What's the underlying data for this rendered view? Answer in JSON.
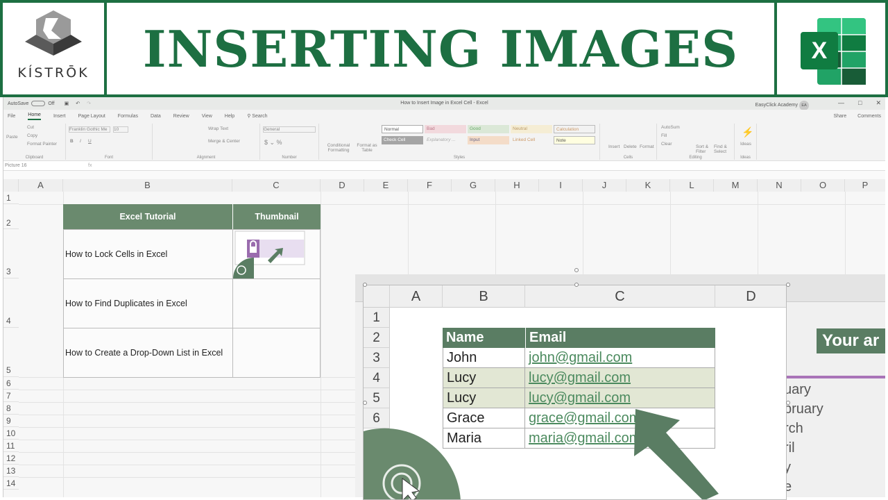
{
  "banner": {
    "title": "INSERTING IMAGES",
    "logo_text": "KÍSTRŌK",
    "excel_icon_letter": "X",
    "colors": {
      "brand_green": "#1d6f42",
      "header_green": "#6a8a6e"
    }
  },
  "window": {
    "autosave_label": "AutoSave",
    "autosave_state": "Off",
    "title": "How to Insert Image in Excel Cell  -  Excel",
    "user": "EasyClick Academy",
    "user_initials": "EA"
  },
  "tabs": {
    "items": [
      "File",
      "Home",
      "Insert",
      "Page Layout",
      "Formulas",
      "Data",
      "Review",
      "View",
      "Help"
    ],
    "active": "Home",
    "search": "Search",
    "share": "Share",
    "comments": "Comments"
  },
  "ribbon": {
    "clipboard": {
      "paste": "Paste",
      "cut": "Cut",
      "copy": "Copy",
      "format_painter": "Format Painter",
      "label": "Clipboard"
    },
    "font": {
      "name": "Franklin Gothic Me",
      "size": "10",
      "label": "Font"
    },
    "alignment": {
      "wrap": "Wrap Text",
      "merge": "Merge & Center",
      "label": "Alignment"
    },
    "number": {
      "format": "General",
      "label": "Number"
    },
    "styles": {
      "conditional": "Conditional Formatting",
      "format_table": "Format as Table",
      "cells": [
        "Normal",
        "Bad",
        "Good",
        "Neutral",
        "Calculation",
        "Check Cell",
        "Explanatory ...",
        "Input",
        "Linked Cell",
        "Note"
      ],
      "label": "Styles"
    },
    "cells": {
      "insert": "Insert",
      "delete": "Delete",
      "format": "Format",
      "label": "Cells"
    },
    "editing": {
      "autosum": "AutoSum",
      "fill": "Fill",
      "clear": "Clear",
      "sort": "Sort & Filter",
      "find": "Find & Select",
      "label": "Editing"
    },
    "ideas": {
      "ideas": "Ideas",
      "label": "Ideas"
    }
  },
  "formula_bar": {
    "name_box": "Picture 16",
    "fx": "fx"
  },
  "sheet": {
    "columns": [
      "A",
      "B",
      "C",
      "D",
      "E",
      "F",
      "G",
      "H",
      "I",
      "J",
      "K",
      "L",
      "M",
      "N",
      "O",
      "P"
    ],
    "rows": [
      "1",
      "2",
      "3",
      "4",
      "5",
      "6",
      "7",
      "8",
      "9",
      "10",
      "11",
      "12",
      "13",
      "14"
    ],
    "table_headers": [
      "Excel Tutorial",
      "Thumbnail"
    ],
    "table_rows": [
      "How to Lock Cells in Excel",
      "How to Find Duplicates in Excel",
      "How to Create a Drop-Down List in Excel"
    ]
  },
  "picture": {
    "columns": [
      "A",
      "B",
      "C",
      "D"
    ],
    "rows": [
      "1",
      "2",
      "3",
      "4",
      "5",
      "6"
    ],
    "headers": [
      "Name",
      "Email"
    ],
    "data": [
      {
        "name": "John",
        "email": "john@gmail.com",
        "highlight": false
      },
      {
        "name": "Lucy",
        "email": "lucy@gmail.com",
        "highlight": true
      },
      {
        "name": "Lucy",
        "email": "lucy@gmail.com",
        "highlight": true
      },
      {
        "name": "Grace",
        "email": "grace@gmail.com",
        "highlight": false
      },
      {
        "name": "Maria",
        "email": "maria@gmail.com",
        "highlight": false
      }
    ],
    "background_header": "Your ar",
    "background_months": [
      "uary",
      "bruary",
      "rch",
      "ril",
      "y",
      "e"
    ]
  }
}
